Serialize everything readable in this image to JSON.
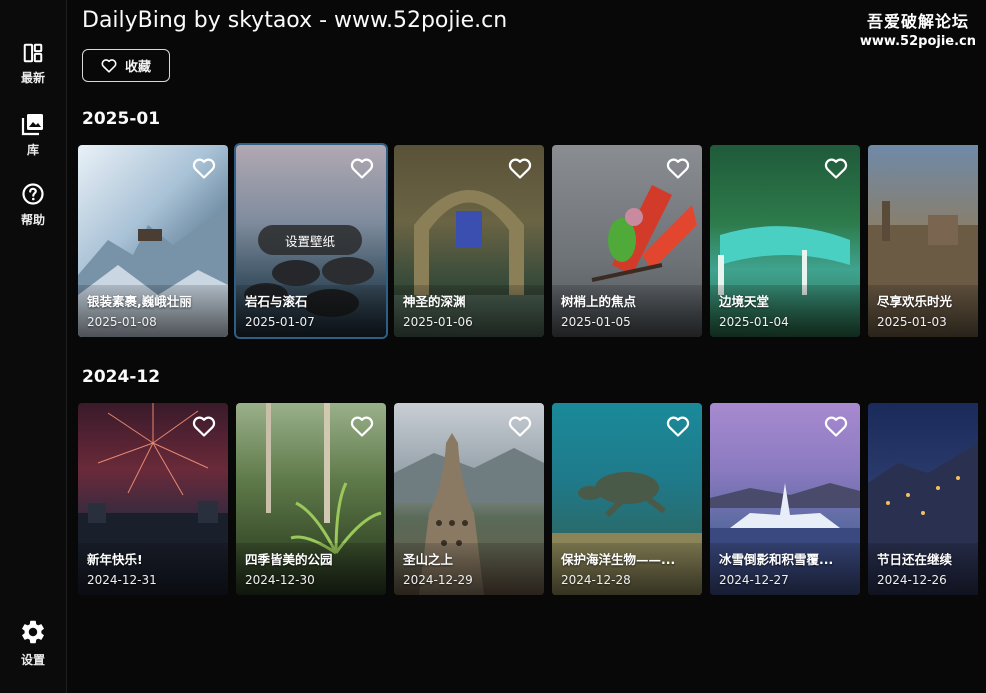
{
  "window": {
    "title": "DailyBing by skytaox - www.52pojie.cn"
  },
  "watermark": {
    "line1": "吾爱破解论坛",
    "line2": "www.52pojie.cn"
  },
  "sidebar": {
    "items": [
      {
        "label": "最新",
        "icon": "dashboard-icon"
      },
      {
        "label": "库",
        "icon": "photo-library-icon"
      },
      {
        "label": "帮助",
        "icon": "help-icon"
      }
    ],
    "settings": {
      "label": "设置",
      "icon": "gear-icon"
    }
  },
  "toolbar": {
    "favorite_label": "收藏"
  },
  "sections": [
    {
      "title": "2025-01",
      "cards": [
        {
          "title": "银装素裹,巍峨壮丽",
          "date": "2025-01-08"
        },
        {
          "title": "岩石与滚石",
          "date": "2025-01-07",
          "action": "设置壁纸"
        },
        {
          "title": "神圣的深渊",
          "date": "2025-01-06"
        },
        {
          "title": "树梢上的焦点",
          "date": "2025-01-05"
        },
        {
          "title": "边境天堂",
          "date": "2025-01-04"
        },
        {
          "title": "尽享欢乐时光",
          "date": "2025-01-03"
        }
      ]
    },
    {
      "title": "2024-12",
      "cards": [
        {
          "title": "新年快乐!",
          "date": "2024-12-31"
        },
        {
          "title": "四季皆美的公园",
          "date": "2024-12-30"
        },
        {
          "title": "圣山之上",
          "date": "2024-12-29"
        },
        {
          "title": "保护海洋生物——...",
          "date": "2024-12-28"
        },
        {
          "title": "冰雪倒影和积雪覆...",
          "date": "2024-12-27"
        },
        {
          "title": "节日还在继续",
          "date": "2024-12-26"
        }
      ]
    }
  ],
  "colors": {
    "background": "#080808",
    "hover_border": "#2f5e86"
  }
}
